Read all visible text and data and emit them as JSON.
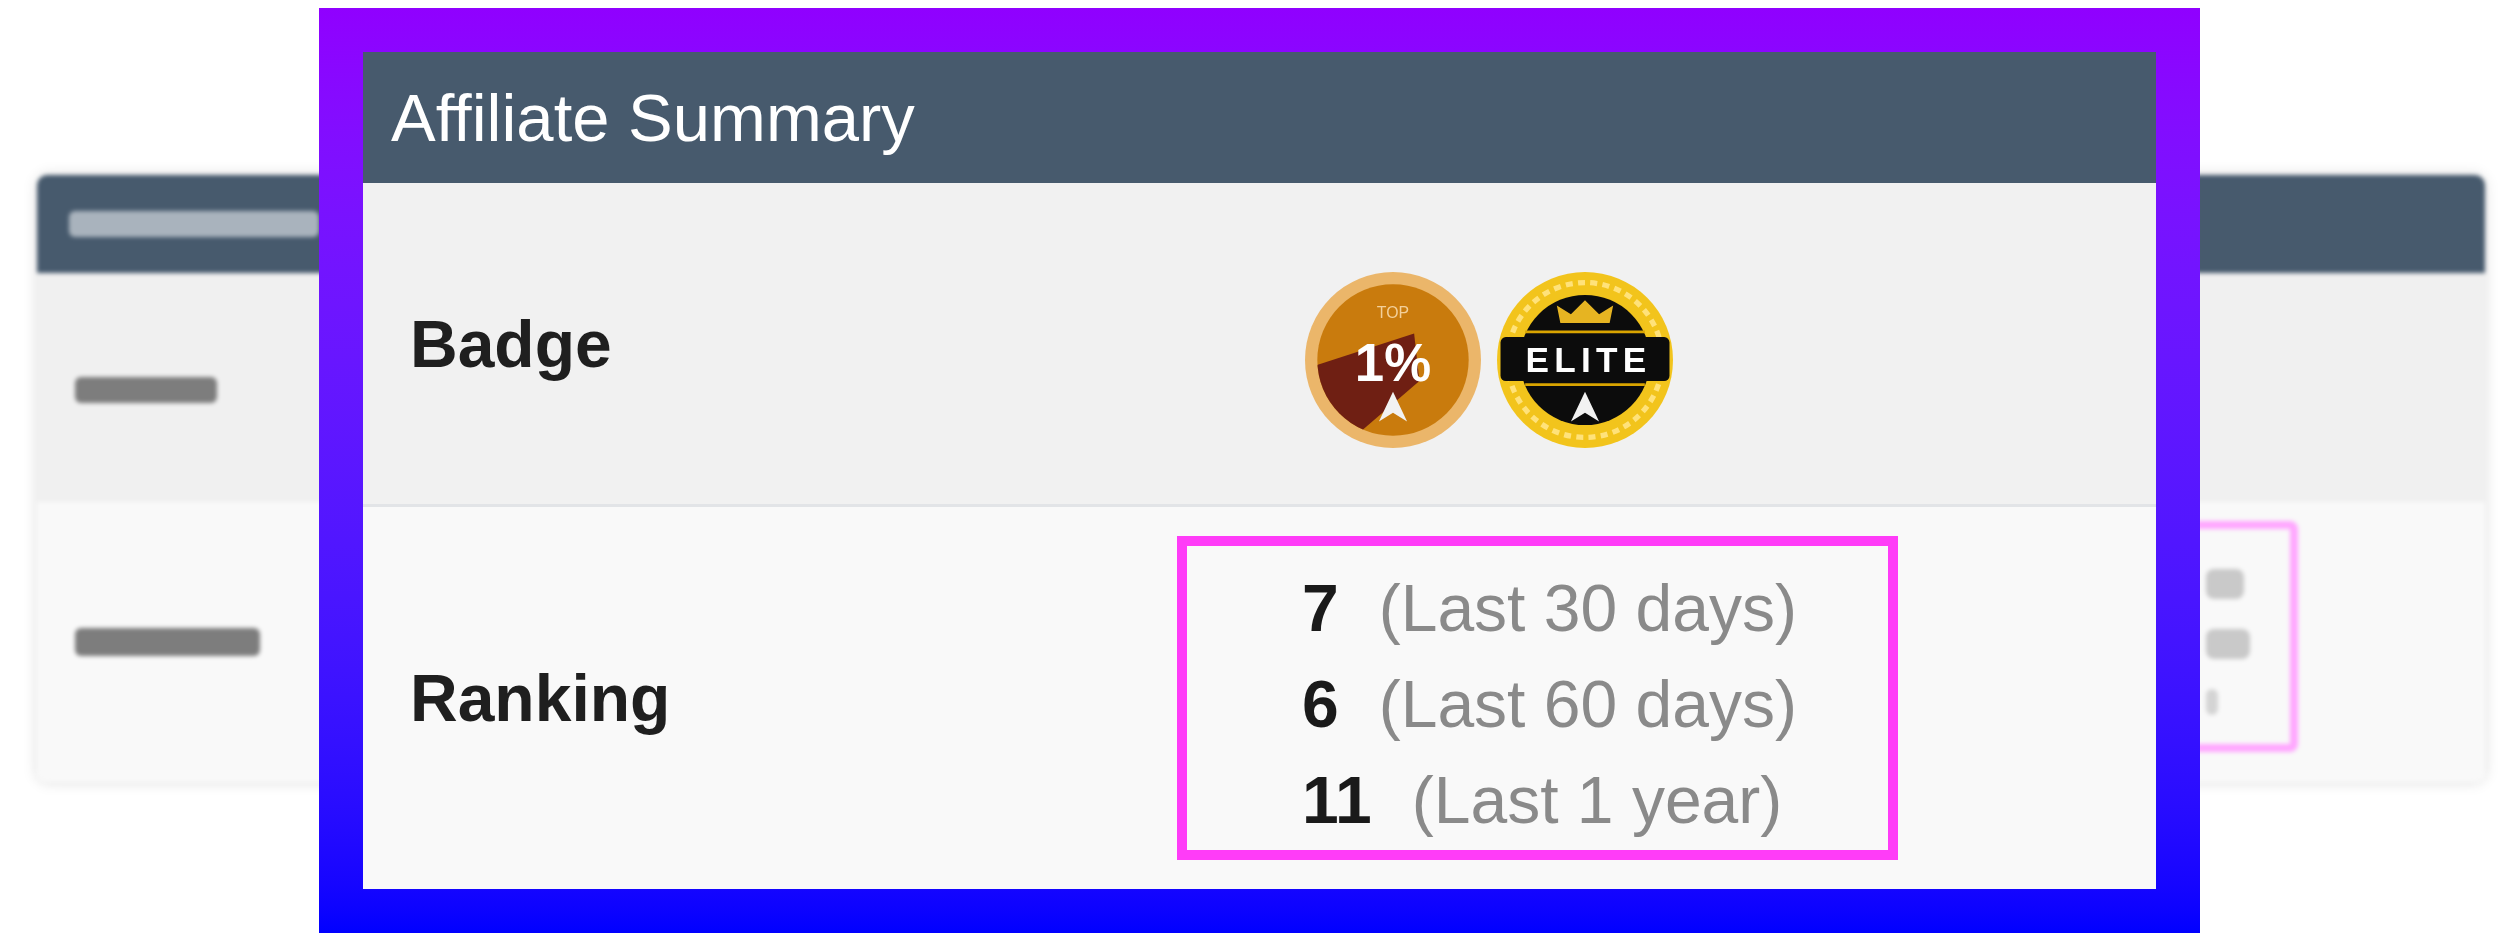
{
  "background_card": {
    "ranking_row": {
      "highlighted": true
    }
  },
  "summary_card": {
    "title": "Affiliate Summary",
    "badge_row": {
      "label": "Badge",
      "badges": [
        {
          "kind": "top_percent",
          "caption": "TOP",
          "value": "1%"
        },
        {
          "kind": "elite",
          "value": "ELITE"
        }
      ]
    },
    "ranking_row": {
      "label": "Ranking",
      "highlighted": true,
      "rankings": [
        {
          "rank": "7",
          "period": "(Last 30 days)"
        },
        {
          "rank": "6",
          "period": "(Last 60 days)"
        },
        {
          "rank": "11",
          "period": "(Last 1 year)"
        }
      ]
    }
  }
}
